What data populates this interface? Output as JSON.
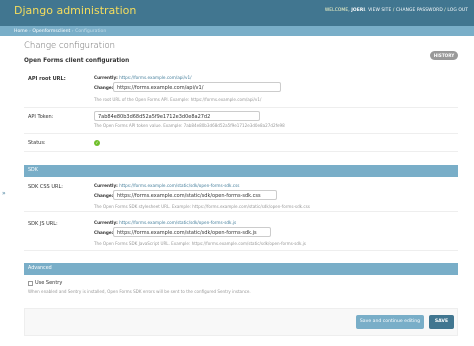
{
  "header": {
    "title": "Django administration",
    "welcome": "WELCOME,",
    "user": "JOERI",
    "view_site": "VIEW SITE",
    "change_password": "CHANGE PASSWORD",
    "log_out": "LOG OUT",
    "separator": " / "
  },
  "breadcrumbs": {
    "home": "Home",
    "app": "Openformsclient",
    "current": "Configuration",
    "separator": " › "
  },
  "page": {
    "title": "Change configuration",
    "history_button": "HISTORY",
    "section_title": "Open Forms client configuration"
  },
  "fields": {
    "api_root": {
      "label": "API root URL:",
      "currently_label": "Currently:",
      "currently_value": "https://forms.example.com/api/v1/",
      "change_label": "Change:",
      "value": "https://forms.example.com/api/v1/",
      "help": "The root URL of the Open Forms API. Example: https://forms.example.com/api/v1/"
    },
    "api_token": {
      "label": "API Token:",
      "value": "7ab84e80b3d68d52a5f9e1712e3d0e8a27d2",
      "help": "The Open Forms API token value. Example: 7ab84e80b3d68d52a5f9e1712e3d0e8a27d2fe98"
    },
    "status": {
      "label": "Status:",
      "icon": "check-icon",
      "icon_glyph": "✓",
      "color": "#70bf2b"
    }
  },
  "sdk": {
    "heading": "SDK",
    "css": {
      "label": "SDK CSS URL:",
      "currently_label": "Currently:",
      "currently_value": "https://forms.example.com/static/sdk/open-forms-sdk.css",
      "change_label": "Change:",
      "value": "https://forms.example.com/static/sdk/open-forms-sdk.css",
      "help": "The Open Forms SDK stylesheet URL. Example: https://forms.example.com/static/sdk/open-forms-sdk.css"
    },
    "js": {
      "label": "SDK JS URL:",
      "currently_label": "Currently:",
      "currently_value": "https://forms.example.com/static/sdk/open-forms-sdk.js",
      "change_label": "Change:",
      "value": "https://forms.example.com/static/sdk/open-forms-sdk.js",
      "help": "The Open Forms SDK JavaScript URL. Example: https://forms.example.com/static/sdk/open-forms-sdk.js"
    }
  },
  "advanced": {
    "heading": "Advanced",
    "use_sentry_label": "Use Sentry",
    "use_sentry_checked": false,
    "use_sentry_help": "When enabled and Sentry is installed, Open Forms SDK errors will be sent to the configured Sentry instance."
  },
  "submit": {
    "continue_label": "Save and continue editing",
    "save_label": "SAVE"
  },
  "sidebar_toggle": "»",
  "colors": {
    "header_bg": "#417690",
    "branding": "#f5dd5d",
    "breadcrumbs_bg": "#79aec8",
    "link": "#447e9b",
    "success": "#70bf2b"
  }
}
